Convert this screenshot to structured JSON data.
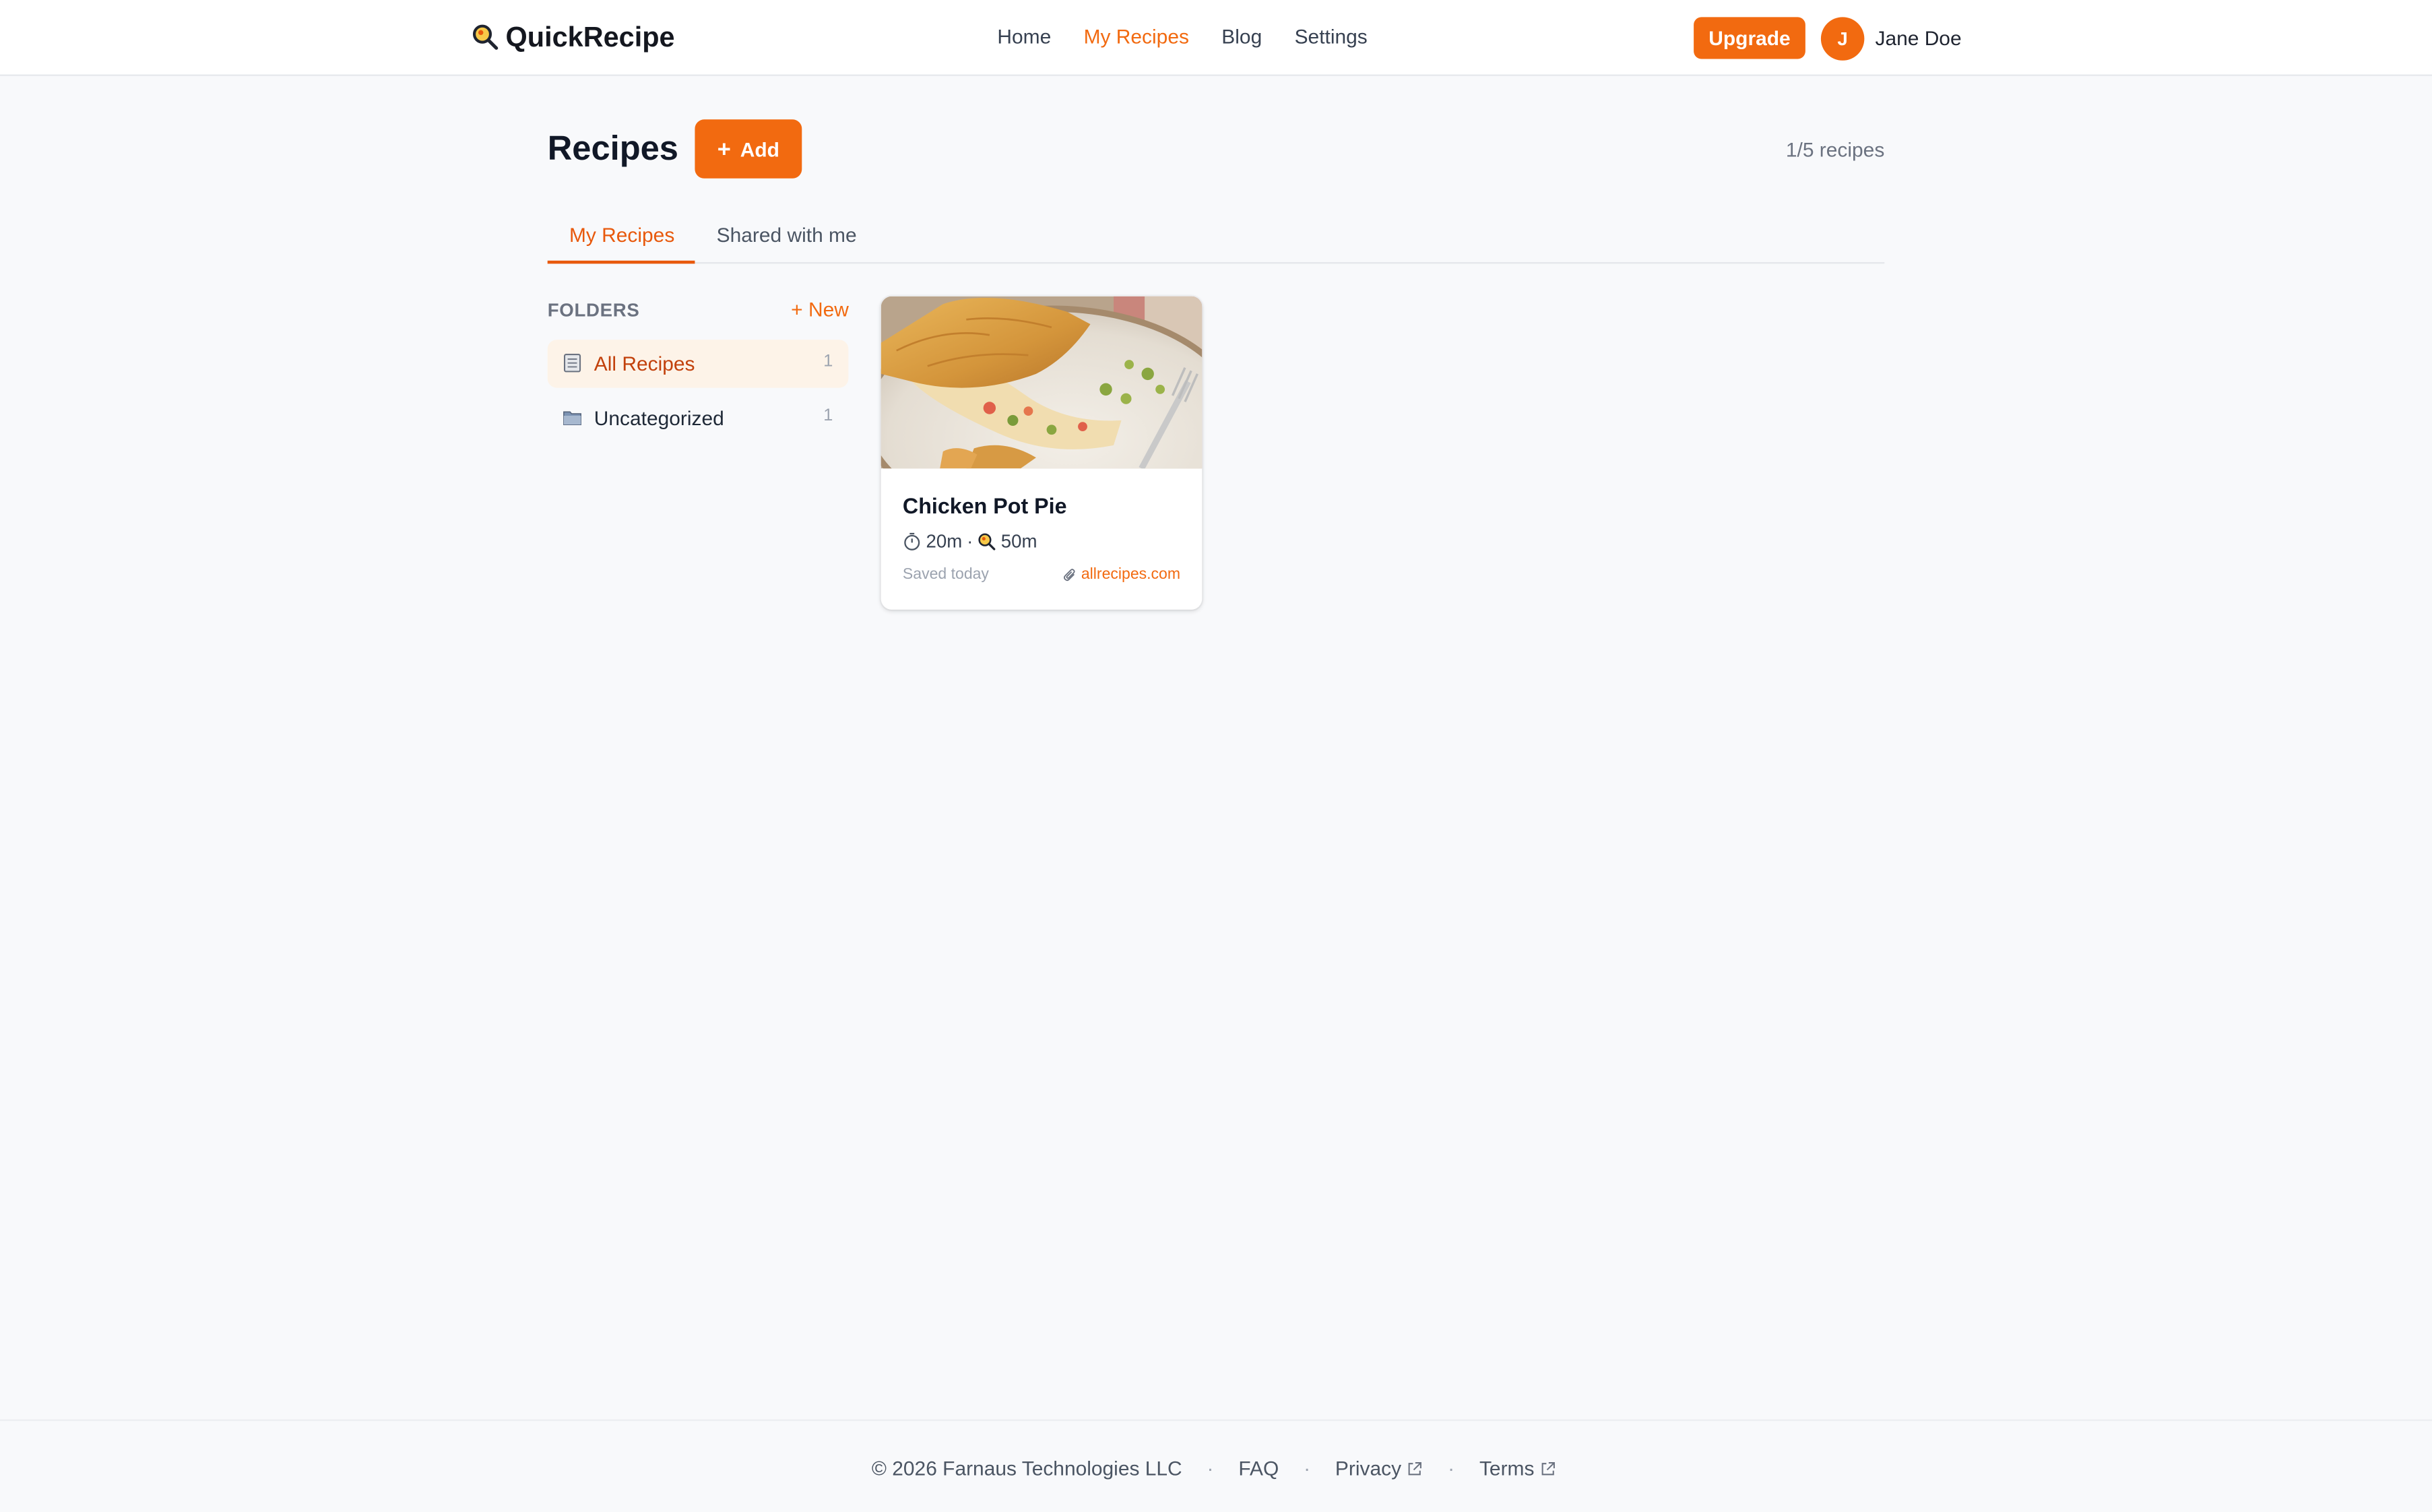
{
  "header": {
    "brand": "QuickRecipe",
    "nav": [
      {
        "label": "Home",
        "active": false
      },
      {
        "label": "My Recipes",
        "active": true
      },
      {
        "label": "Blog",
        "active": false
      },
      {
        "label": "Settings",
        "active": false
      }
    ],
    "upgrade_label": "Upgrade",
    "avatar_initial": "J",
    "user_name": "Jane Doe"
  },
  "page": {
    "title": "Recipes",
    "add_label": "Add",
    "count": "1/5 recipes"
  },
  "tabs": [
    {
      "label": "My Recipes",
      "active": true
    },
    {
      "label": "Shared with me",
      "active": false
    }
  ],
  "sidebar": {
    "title": "FOLDERS",
    "new_label": "+ New",
    "folders": [
      {
        "label": "All Recipes",
        "count": "1",
        "active": true,
        "icon": "notebook-icon"
      },
      {
        "label": "Uncategorized",
        "count": "1",
        "active": false,
        "icon": "folder-icon"
      }
    ]
  },
  "recipes": [
    {
      "title": "Chicken Pot Pie",
      "prep_time": "20m",
      "cook_time": "50m",
      "separator": "·",
      "saved": "Saved today",
      "source": "allrecipes.com"
    }
  ],
  "footer": {
    "copyright": "© 2026 Farnaus Technologies LLC",
    "links": [
      "FAQ",
      "Privacy",
      "Terms"
    ]
  },
  "colors": {
    "accent": "#f26a10",
    "background": "#f8f9fb",
    "active_folder_bg": "#fdf3e8"
  }
}
